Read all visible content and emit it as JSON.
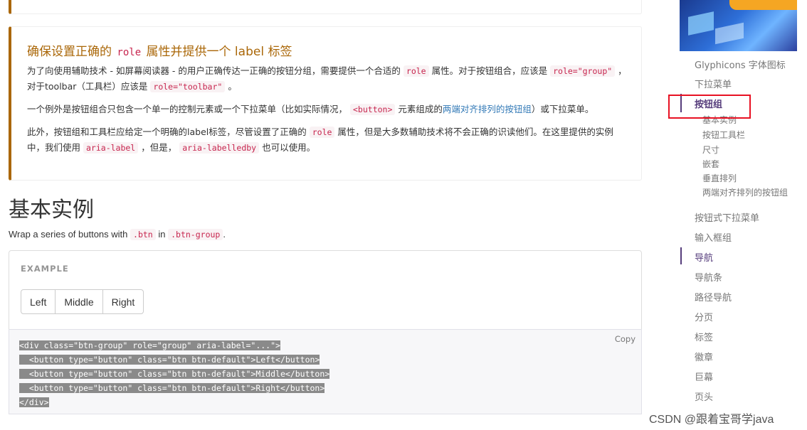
{
  "callout": {
    "title_pre": "确保设置正确的",
    "title_code": "role",
    "title_post": "属性并提供一个 label 标签",
    "p1": {
      "t1": "为了向使用辅助技术 - 如屏幕阅读器 - 的用户正确传达一正确的按钮分组，需要提供一个合适的",
      "c1": "role",
      "t2": "属性。对于按钮组合，应该是",
      "c2": "role=\"group\"",
      "t3": "，对于toolbar（工具栏）应该是",
      "c3": "role=\"toolbar\"",
      "t4": "。"
    },
    "p2": {
      "t1": "一个例外是按钮组合只包含一个单一的控制元素或一个下拉菜单（比如实际情况，",
      "c1": "<button>",
      "t2": "元素组成的",
      "link": "两端对齐排列的按钮组",
      "t3": "）或下拉菜单。"
    },
    "p3": {
      "t1": "此外，按钮组和工具栏应给定一个明确的label标签，尽管设置了正确的",
      "c1": "role",
      "t2": "属性，但是大多数辅助技术将不会正确的识读他们。在这里提供的实例中，我们使用",
      "c2": "aria-label",
      "t3": "，但是，",
      "c3": "aria-labelledby",
      "t4": "也可以使用。"
    }
  },
  "section": {
    "title": "基本实例",
    "lead_pre": "Wrap a series of buttons with",
    "lead_code1": ".btn",
    "lead_mid": "in",
    "lead_code2": ".btn-group",
    "lead_post": "."
  },
  "example": {
    "label": "EXAMPLE",
    "buttons": [
      "Left",
      "Middle",
      "Right"
    ]
  },
  "code": {
    "copy": "Copy",
    "lines": [
      "<div class=\"btn-group\" role=\"group\" aria-label=\"...\">",
      "  <button type=\"button\" class=\"btn btn-default\">Left</button>",
      "  <button type=\"button\" class=\"btn btn-default\">Middle</button>",
      "  <button type=\"button\" class=\"btn btn-default\">Right</button>",
      "</div>"
    ]
  },
  "sidebar": {
    "items": [
      "Glyphicons 字体图标",
      "下拉菜单",
      "按钮组",
      "按钮式下拉菜单",
      "输入框组",
      "导航",
      "导航条",
      "路径导航",
      "分页",
      "标签",
      "徽章",
      "巨幕",
      "页头"
    ],
    "subitems": [
      "基本实例",
      "按钮工具栏",
      "尺寸",
      "嵌套",
      "垂直排列",
      "两端对齐排列的按钮组"
    ]
  },
  "watermark": "CSDN @跟着宝哥学java",
  "colors": {
    "warning": "#aa6708",
    "code": "#c7254e",
    "link": "#337ab7",
    "active_nav": "#563d7c",
    "highlight_box": "#e81123"
  }
}
